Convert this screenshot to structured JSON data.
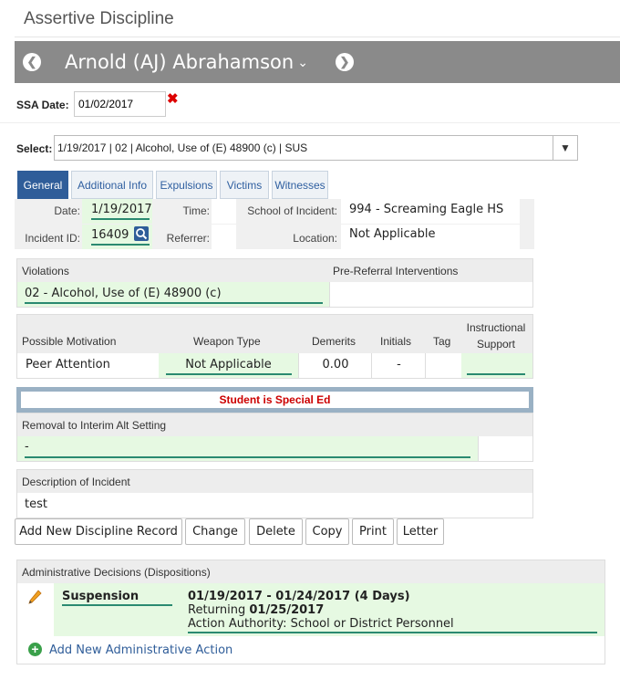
{
  "app": {
    "title": "Assertive Discipline"
  },
  "header": {
    "student_name": "Arnold (AJ) Abrahamson",
    "prev_icon": "arrow-left-circle-icon",
    "next_icon": "arrow-right-circle-icon",
    "dropdown_icon": "chevron-down-icon"
  },
  "ssa": {
    "label": "SSA Date:",
    "value": "01/02/2017",
    "clear_icon": "x-icon"
  },
  "select": {
    "label": "Select:",
    "value": "1/19/2017 | 02 | Alcohol, Use of (E) 48900 (c) | SUS"
  },
  "tabs": [
    {
      "label": "General",
      "active": true
    },
    {
      "label": "Additional Info",
      "active": false
    },
    {
      "label": "Expulsions",
      "active": false
    },
    {
      "label": "Victims",
      "active": false
    },
    {
      "label": "Witnesses",
      "active": false
    }
  ],
  "general": {
    "date_label": "Date:",
    "date_value": "1/19/2017",
    "time_label": "Time:",
    "time_value": "",
    "school_label": "School of Incident:",
    "school_value": "994 - Screaming Eagle HS",
    "incident_id_label": "Incident ID:",
    "incident_id_value": "16409",
    "referrer_label": "Referrer:",
    "referrer_value": "",
    "location_label": "Location:",
    "location_value": "Not Applicable"
  },
  "violations": {
    "header": "Violations",
    "interventions_header": "Pre-Referral Interventions",
    "value": "02 - Alcohol, Use of (E) 48900 (c)"
  },
  "motivation_table": {
    "headers": [
      "Possible Motivation",
      "Weapon Type",
      "Demerits",
      "Initials",
      "Tag",
      "Instructional Support"
    ],
    "values": [
      "Peer Attention",
      "Not Applicable",
      "0.00",
      "-",
      "",
      ""
    ]
  },
  "special_ed": {
    "text": "Student is Special Ed"
  },
  "removal": {
    "header": "Removal to Interim Alt Setting",
    "value": "-"
  },
  "description": {
    "header": "Description of Incident",
    "value": "test"
  },
  "buttons": {
    "add_new": "Add New Discipline Record",
    "change": "Change",
    "delete": "Delete",
    "copy": "Copy",
    "print": "Print",
    "letter": "Letter"
  },
  "dispositions": {
    "header": "Administrative Decisions (Dispositions)",
    "edit_icon": "pencil-icon",
    "type": "Suspension",
    "range": "01/19/2017 - 01/24/2017 (4 Days)",
    "returning_label": "Returning",
    "returning_date": "01/25/2017",
    "authority": "Action Authority: School or District Personnel",
    "add_icon": "plus-circle-icon",
    "add_label": "Add New Administrative Action"
  },
  "colors": {
    "header_bar": "#8a8a8a",
    "tab_active": "#2f5d99",
    "green_bg": "#e6f9e2",
    "underline": "#2a8a70",
    "alert": "#cc0000",
    "add_icon": "#3aa04a"
  }
}
